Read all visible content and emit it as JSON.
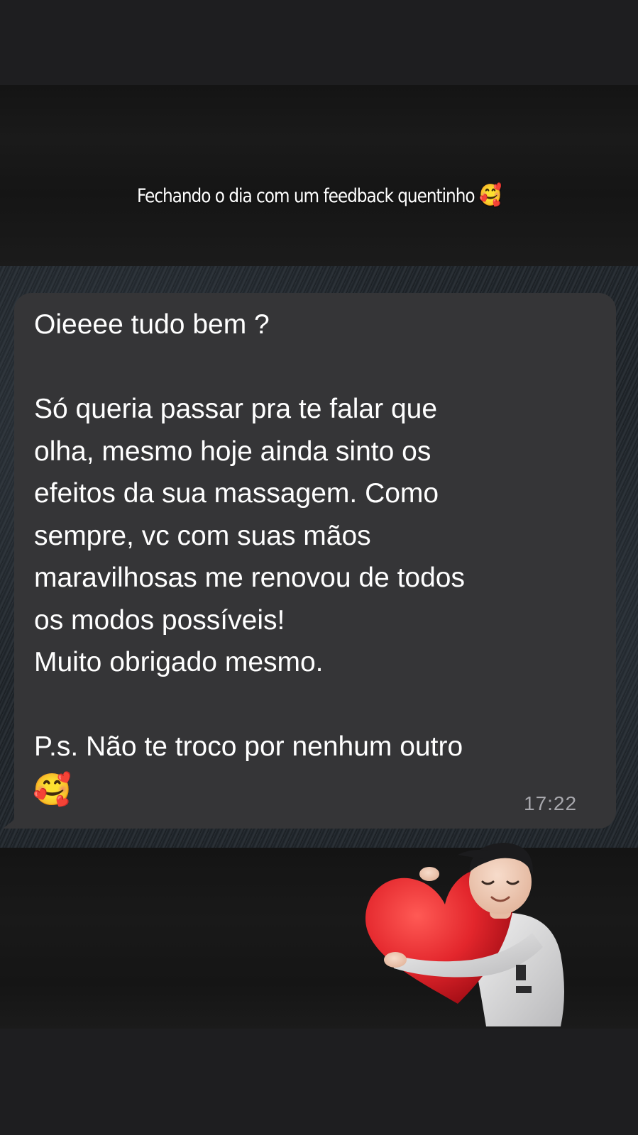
{
  "story": {
    "caption": "Fechando o dia com um feedback quentinho",
    "caption_emoji": "🥰"
  },
  "message": {
    "text": "Oieeee tudo bem ?\n\nSó queria passar pra te falar que\nolha, mesmo hoje ainda sinto os\nefeitos da sua massagem. Como\nsempre, vc com suas mãos\nmaravilhosas me renovou de todos\nos modos possíveis!\nMuito obrigado mesmo.\n\nP.s. Não te troco por nenhum outro",
    "emoji": "🥰",
    "time": "17:22"
  },
  "sticker": {
    "icon": "avatar-hugging-heart-icon"
  },
  "colors": {
    "bubble": "#353537",
    "background": "#1c1c1e",
    "timestamp": "#a8a8ad",
    "heart": "#e3262c"
  }
}
